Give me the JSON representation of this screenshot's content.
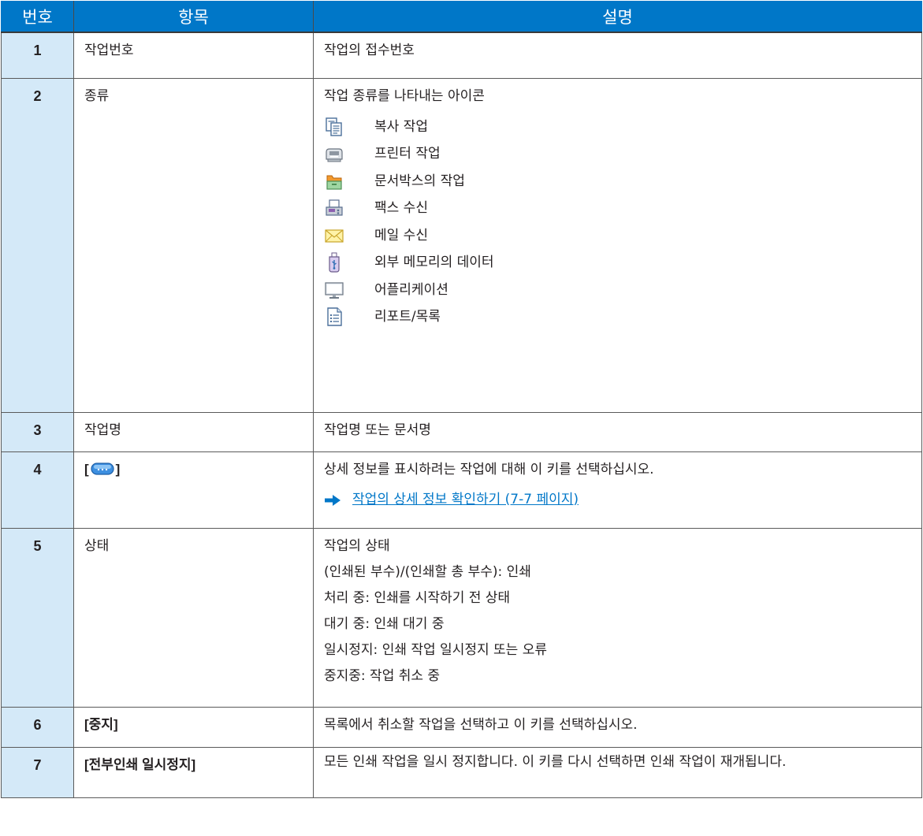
{
  "table": {
    "headers": [
      "번호",
      "항목",
      "설명"
    ],
    "rows": {
      "r1": {
        "num": "1",
        "item": "작업번호",
        "desc": "작업의 접수번호"
      },
      "r2": {
        "num": "2",
        "item": "종류",
        "desc": "작업 종류를 나타내는 아이콘",
        "types": [
          {
            "icon": "copy-job-icon",
            "label": "복사 작업"
          },
          {
            "icon": "printer-job-icon",
            "label": "프린터 작업"
          },
          {
            "icon": "document-box-job-icon",
            "label": "문서박스의 작업"
          },
          {
            "icon": "fax-receive-icon",
            "label": "팩스 수신"
          },
          {
            "icon": "email-receive-icon",
            "label": "메일 수신"
          },
          {
            "icon": "usb-memory-icon",
            "label": "외부 메모리의 데이터"
          },
          {
            "icon": "application-icon",
            "label": "어플리케이션"
          },
          {
            "icon": "report-list-icon",
            "label": "리포트/목록"
          }
        ]
      },
      "r3": {
        "num": "3",
        "item": "작업명",
        "desc": "작업명 또는 문서명"
      },
      "r4": {
        "num": "4",
        "item_open": "[",
        "item_icon": "detail-key-icon",
        "item_close": "]",
        "desc": "상세 정보를 표시하려는 작업에 대해 이 키를 선택하십시오.",
        "link": "작업의 상세 정보 확인하기 (7-7 페이지)"
      },
      "r5": {
        "num": "5",
        "item": "상태",
        "lines": [
          "작업의 상태",
          "(인쇄된 부수)/(인쇄할 총 부수): 인쇄",
          "처리 중: 인쇄를 시작하기 전 상태",
          "대기 중: 인쇄 대기 중",
          "일시정지: 인쇄 작업 일시정지 또는 오류",
          "중지중: 작업 취소 중"
        ]
      },
      "r6": {
        "num": "6",
        "item": "[중지]",
        "desc": "목록에서 취소할 작업을 선택하고 이 키를 선택하십시오."
      },
      "r7": {
        "num": "7",
        "item": "[전부인쇄 일시정지]",
        "desc": "모든 인쇄 작업을 일시 정지합니다. 이 키를 다시 선택하면 인쇄 작업이 재개됩니다."
      }
    }
  },
  "colors": {
    "header_bg": "#0077c8",
    "number_cell_bg": "#d4e9f8",
    "link": "#0077c8"
  }
}
